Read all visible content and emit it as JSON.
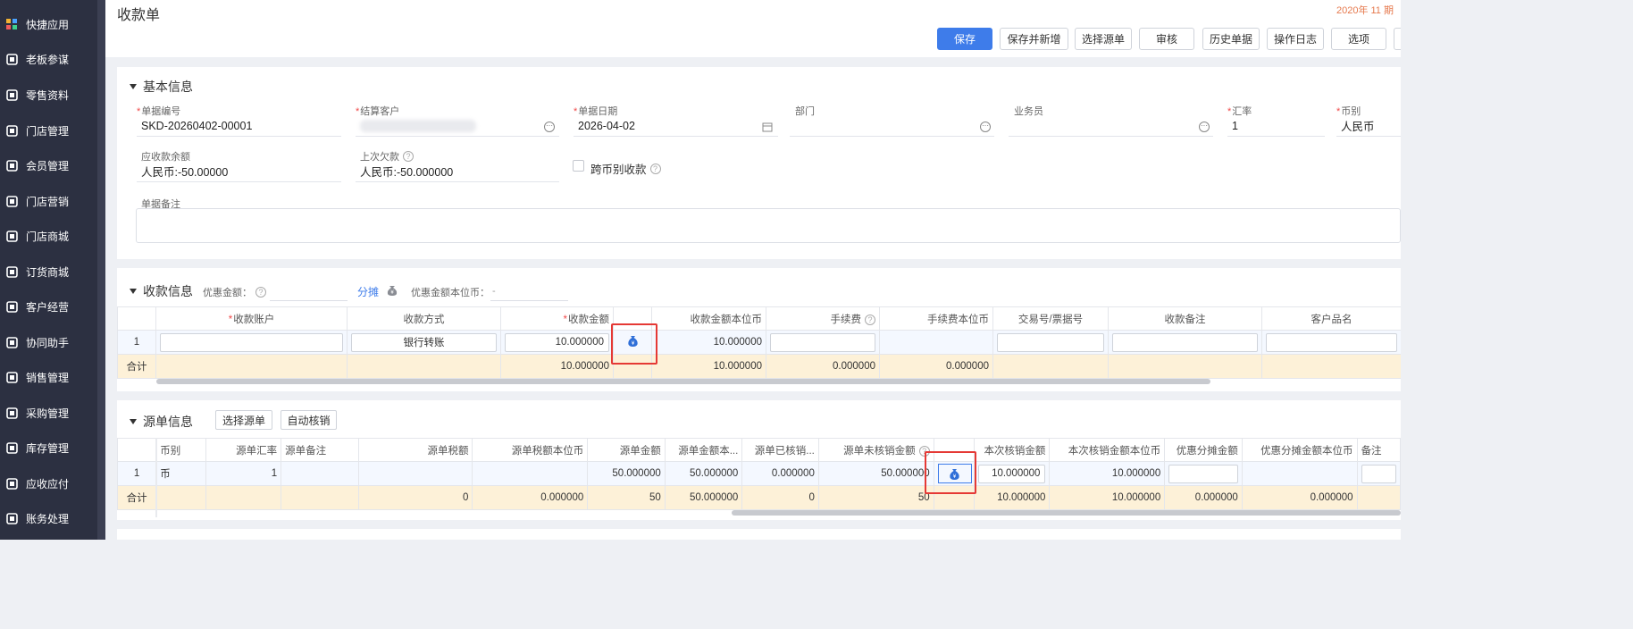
{
  "sidebar": {
    "items": [
      {
        "label": "快捷应用",
        "icon": "app-grid-icon"
      },
      {
        "label": "老板参谋",
        "icon": "chart-icon"
      },
      {
        "label": "零售资料",
        "icon": "store-basket-icon"
      },
      {
        "label": "门店管理",
        "icon": "store-icon"
      },
      {
        "label": "会员管理",
        "icon": "member-heart-icon"
      },
      {
        "label": "门店营销",
        "icon": "clipboard-icon"
      },
      {
        "label": "门店商城",
        "icon": "shop-icon"
      },
      {
        "label": "订货商城",
        "icon": "shopping-bag-icon"
      },
      {
        "label": "客户经营",
        "icon": "customer-icon"
      },
      {
        "label": "协同助手",
        "icon": "collaboration-icon"
      },
      {
        "label": "销售管理",
        "icon": "sales-icon"
      },
      {
        "label": "采购管理",
        "icon": "purchase-cart-icon"
      },
      {
        "label": "库存管理",
        "icon": "inventory-icon"
      },
      {
        "label": "应收应付",
        "icon": "receivable-icon"
      },
      {
        "label": "账务处理",
        "icon": "accounting-icon"
      }
    ]
  },
  "header": {
    "title": "收款单",
    "date_hint": "2020年 11 期",
    "buttons": [
      "保存",
      "保存并新增",
      "选择源单",
      "审核",
      "历史单据",
      "操作日志",
      "选项"
    ]
  },
  "basic": {
    "title": "基本信息",
    "doc_no_label": "单据编号",
    "doc_no": "SKD-20260402-00001",
    "customer_label": "结算客户",
    "date_label": "单据日期",
    "date": "2026-04-02",
    "dept_label": "部门",
    "salesman_label": "业务员",
    "rate_label": "汇率",
    "rate": "1",
    "currency_label": "币别",
    "currency": "人民币",
    "receivable_label": "应收款余额",
    "receivable": "人民币:-50.00000",
    "last_owed_label": "上次欠款",
    "last_owed": "人民币:-50.000000",
    "cross_currency_label": "跨币别收款",
    "remark_label": "单据备注"
  },
  "receipt": {
    "title": "收款信息",
    "discount_label": "优惠金额：",
    "split_link": "分摊",
    "discount_base_label": "优惠金额本位币：",
    "discount_base_value": "-",
    "columns": [
      "收款账户",
      "收款方式",
      "收款金额",
      "收款金额本位币",
      "手续费",
      "手续费本位币",
      "交易号/票据号",
      "收款备注",
      "客户品名"
    ],
    "row": {
      "no": "1",
      "method": "银行转账",
      "amount": "10.000000",
      "amount_base": "10.000000"
    },
    "sum": {
      "label": "合计",
      "amount": "10.000000",
      "amount_base": "10.000000",
      "fee": "0.000000",
      "fee_base": "0.000000"
    }
  },
  "source": {
    "title": "源单信息",
    "select_btn": "选择源单",
    "auto_btn": "自动核销",
    "columns": [
      "币别",
      "源单汇率",
      "源单备注",
      "源单税额",
      "源单税额本位币",
      "源单金额",
      "源单金额本...",
      "源单已核销...",
      "源单未核销金额",
      "本次核销金额",
      "本次核销金额本位币",
      "优惠分摊金额",
      "优惠分摊金额本位币",
      "备注"
    ],
    "row": {
      "no": "1",
      "currency": "币",
      "rate": "1",
      "amount": "50.000000",
      "amount_base": "50.000000",
      "written_off": "0.000000",
      "unwritten": "50.000000",
      "this_amount": "10.000000",
      "this_amount_base": "10.000000"
    },
    "sum": {
      "label": "合计",
      "tax": "0",
      "tax_base": "0.000000",
      "amount": "50",
      "amount_base": "50.000000",
      "written_off": "0",
      "unwritten": "50",
      "this_amount": "10.000000",
      "this_amount_base": "10.000000",
      "discount": "0.000000",
      "discount_base": "0.000000"
    }
  }
}
